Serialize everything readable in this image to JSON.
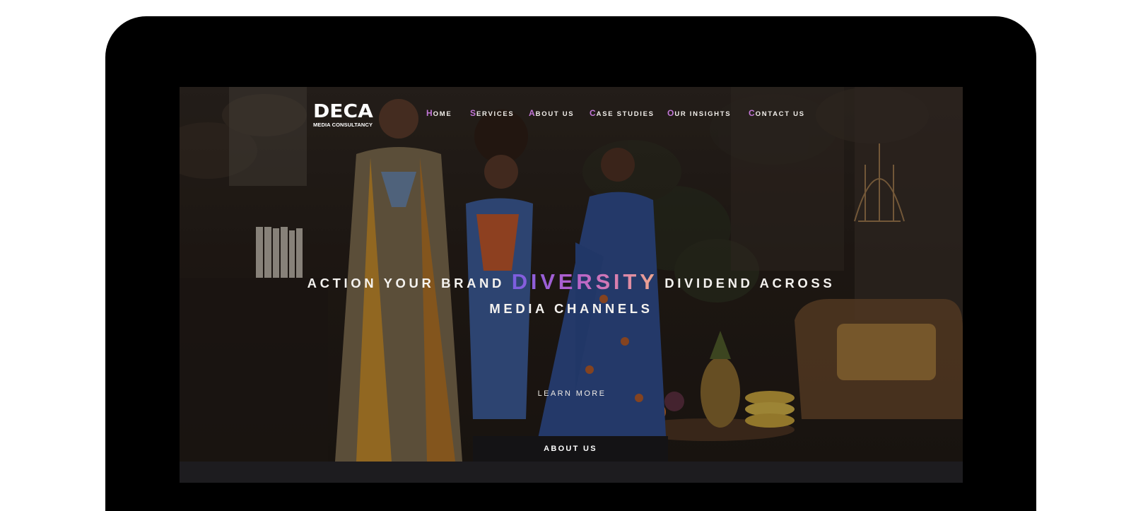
{
  "brand": {
    "logo_mark": "DECA",
    "logo_sub": "MEDIA CONSULTANCY",
    "accent_color": "#c176d6"
  },
  "nav": {
    "items": [
      {
        "first": "H",
        "rest": "ome"
      },
      {
        "first": "S",
        "rest": "ervices"
      },
      {
        "first": "A",
        "rest": "bout us"
      },
      {
        "first": "C",
        "rest": "ase studies"
      },
      {
        "first": "O",
        "rest": "ur insights"
      },
      {
        "first": "C",
        "rest": "ontact us"
      }
    ]
  },
  "hero": {
    "headline_before": "ACTION YOUR BRAND ",
    "headline_accent": "DIVERSITY",
    "headline_after": " DIVIDEND ACROSS",
    "headline_line2": "MEDIA CHANNELS",
    "accent_gradient": [
      "#7a5ee0",
      "#b25fcf",
      "#d87db0",
      "#efa98c"
    ],
    "learn_more": "LEARN MORE"
  },
  "tabs": {
    "about": "ABOUT US"
  }
}
